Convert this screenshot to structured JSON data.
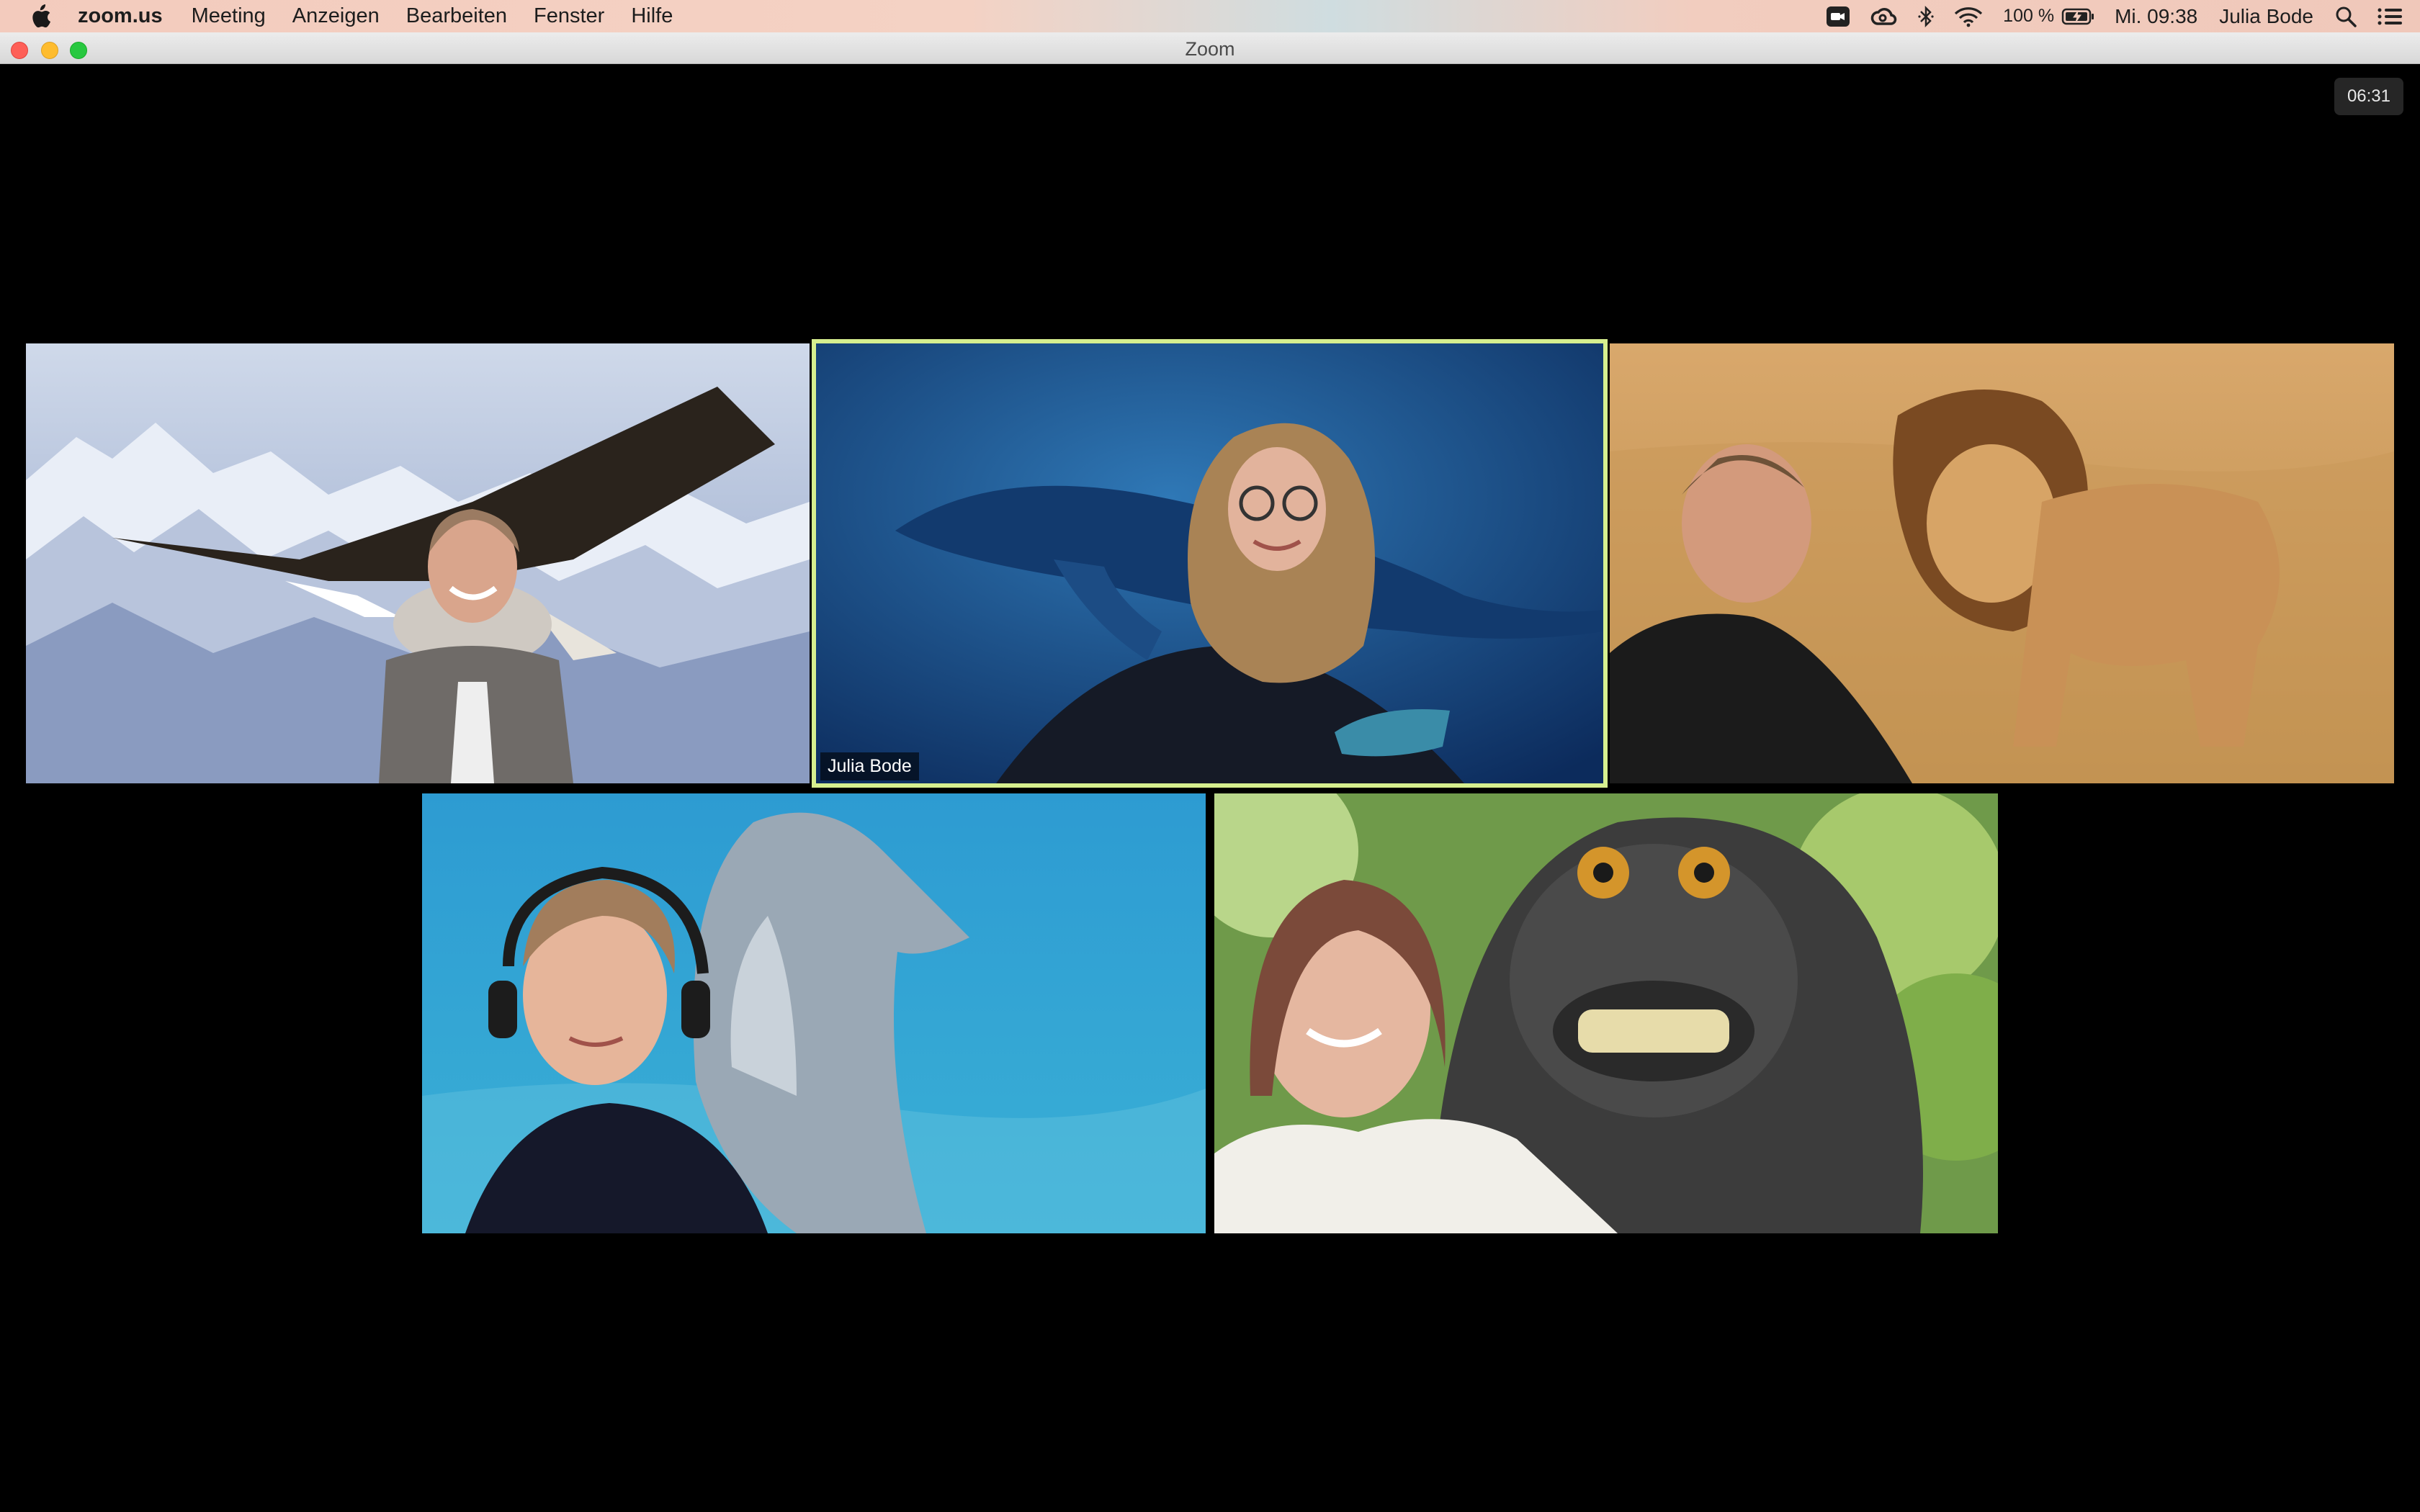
{
  "menubar": {
    "app_name": "zoom.us",
    "items": [
      "Meeting",
      "Anzeigen",
      "Bearbeiten",
      "Fenster",
      "Hilfe"
    ],
    "battery_percent": "100 %",
    "clock": "Mi. 09:38",
    "user": "Julia Bode",
    "icons": [
      "zoom-status-icon",
      "creative-cloud-icon",
      "bluetooth-icon",
      "wifi-icon",
      "battery-icon",
      "spotlight-search-icon",
      "control-center-icon"
    ]
  },
  "window": {
    "title": "Zoom"
  },
  "meeting": {
    "timer": "06:31",
    "active_speaker_color": "#d6ef8f",
    "participants": [
      {
        "background": "eagle-over-mountains",
        "name": ""
      },
      {
        "background": "whale-underwater",
        "name": "Julia Bode",
        "active": true
      },
      {
        "background": "lion-in-grass",
        "name": ""
      },
      {
        "background": "dolphin-underwater",
        "name": ""
      },
      {
        "background": "macaque-selfie",
        "name": ""
      }
    ]
  }
}
